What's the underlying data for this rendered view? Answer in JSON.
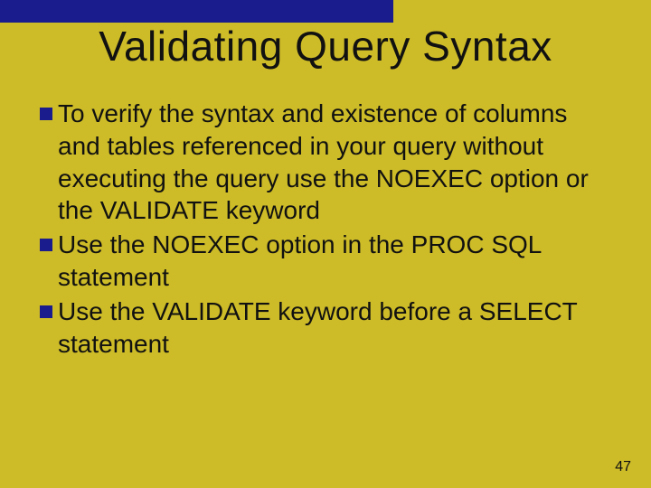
{
  "slide": {
    "title": "Validating Query Syntax",
    "bullets": [
      "To verify the syntax and existence of columns and tables referenced in your query without executing the query use the NOEXEC option or the VALIDATE keyword",
      "Use the NOEXEC option in the PROC SQL statement",
      "Use the VALIDATE keyword before a SELECT statement"
    ],
    "page_number": "47"
  }
}
